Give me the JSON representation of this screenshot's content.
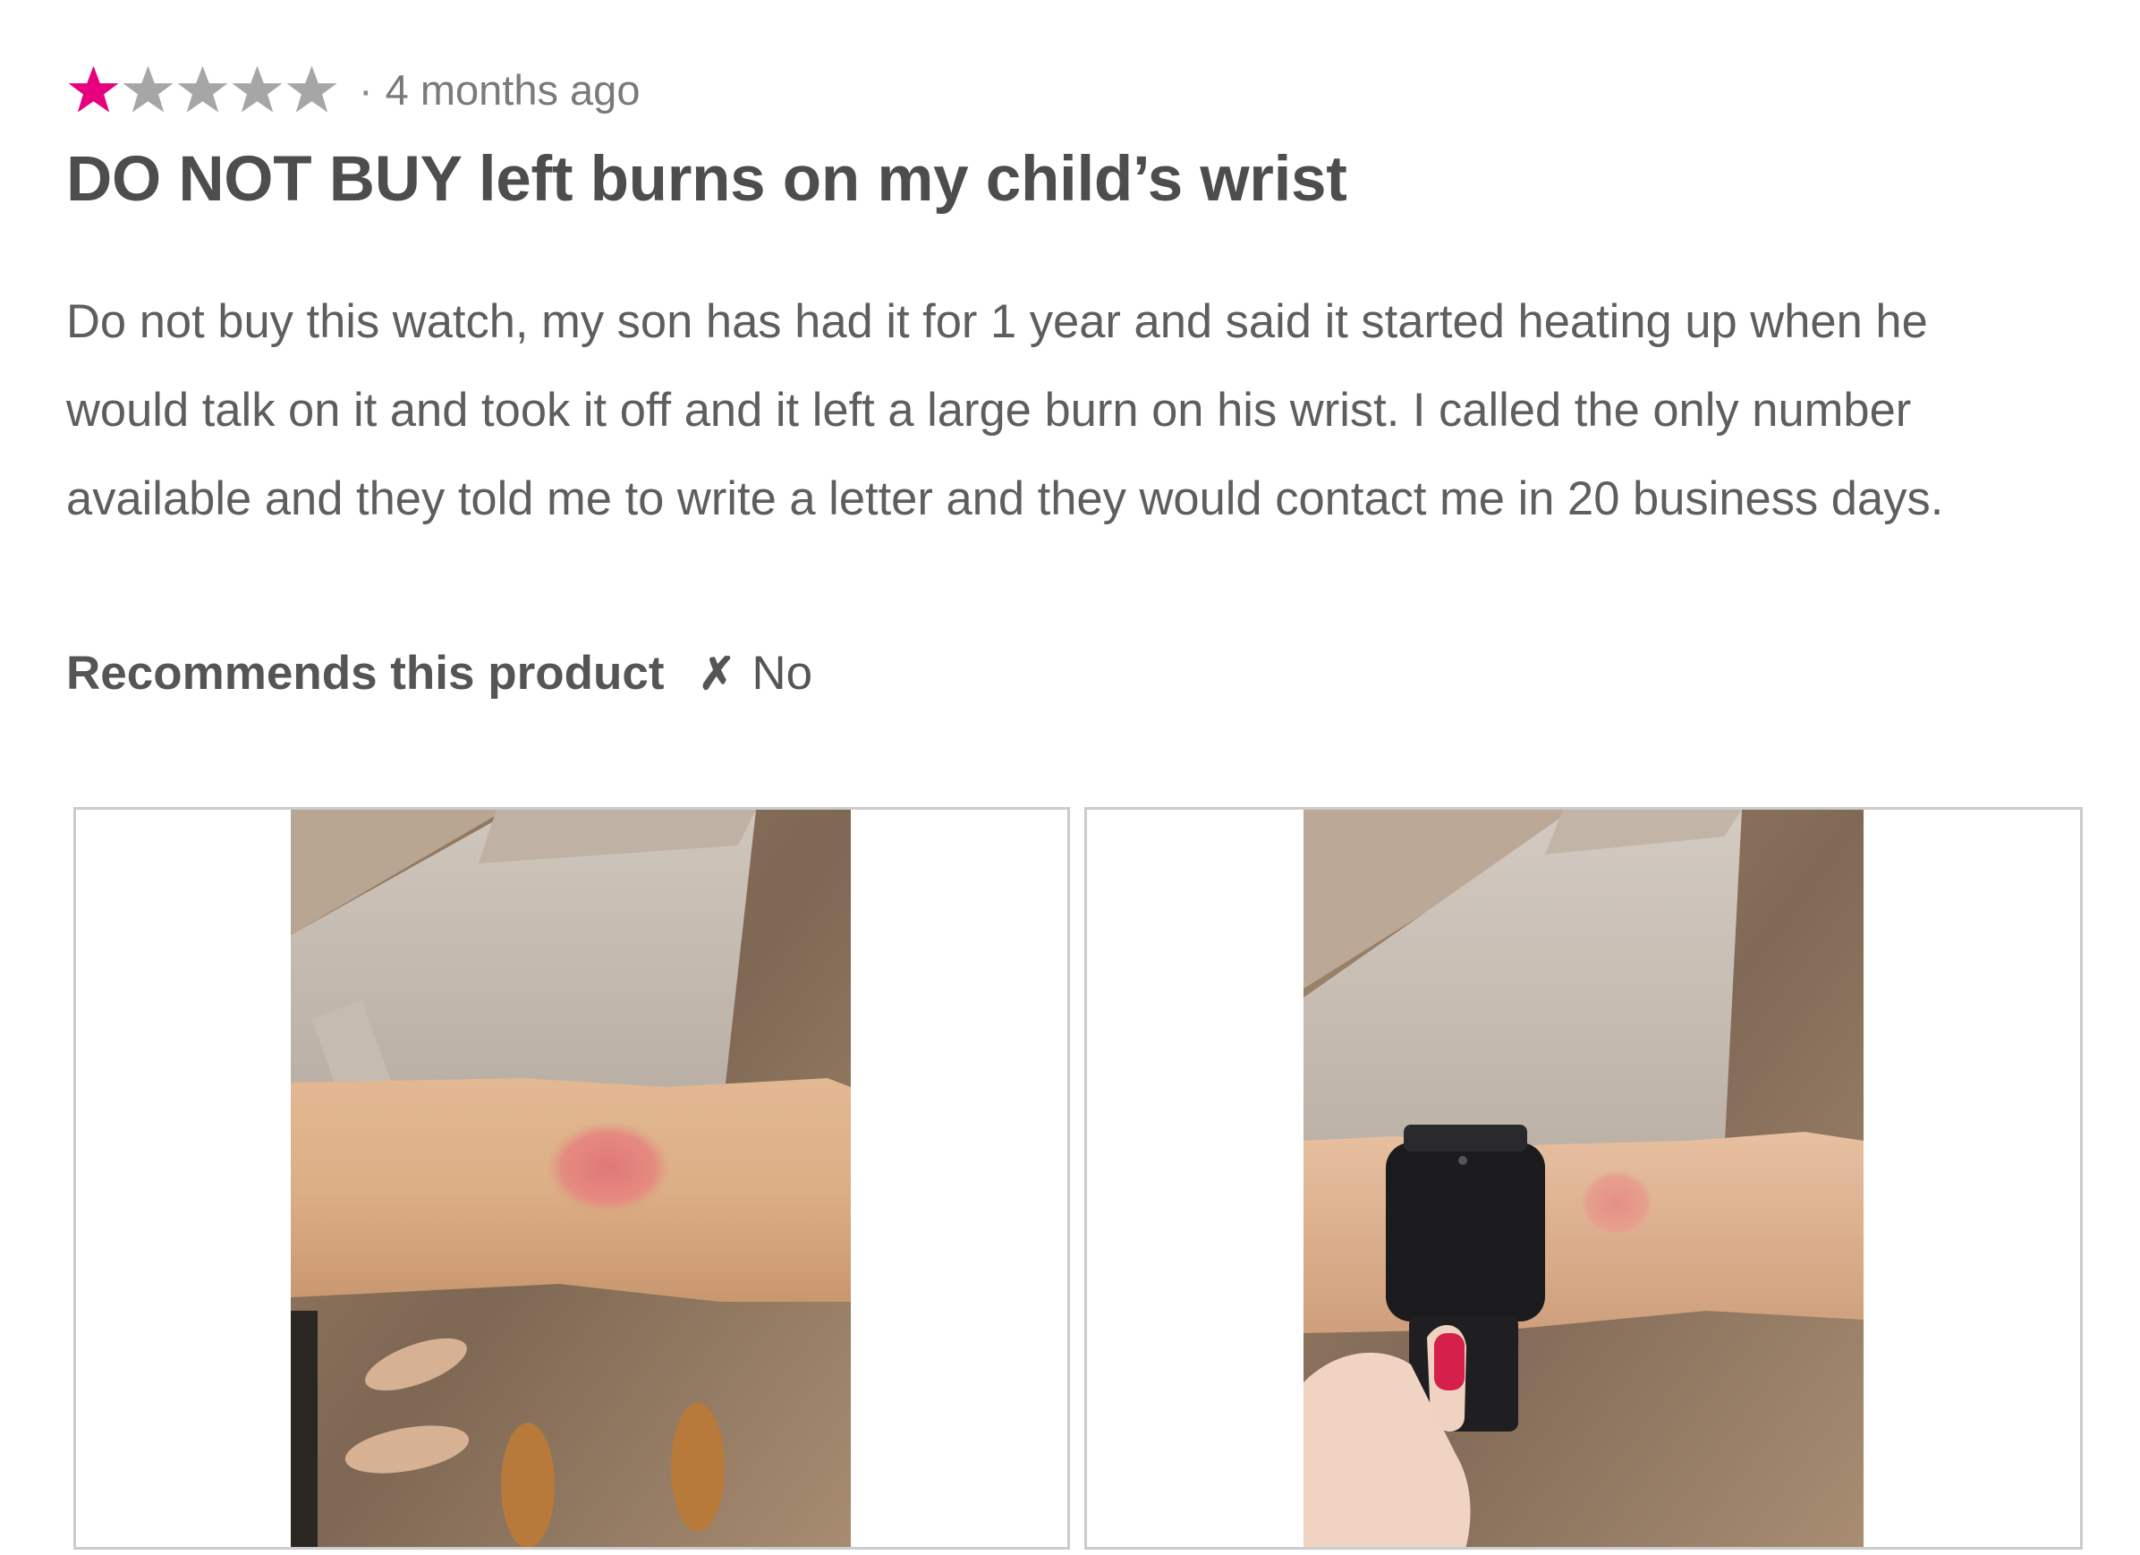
{
  "review": {
    "rating": 1,
    "rating_max": 5,
    "star_color_filled": "#e6007e",
    "star_color_empty": "#a6a6a6",
    "separator": "·",
    "date": "4 months ago",
    "title": "DO NOT BUY left burns on my child’s wrist",
    "body_lines": [
      "Do not buy this watch, my son has had it for 1 year and said it started heating up when he",
      "would talk on it and took it off and it left a large burn on his wrist. I called the only number",
      "available and they told me to write a letter and they would contact me in 20 business days."
    ],
    "recommends": {
      "label": "Recommends this product",
      "icon": "x-mark-icon",
      "icon_glyph": "✗",
      "value": "No"
    },
    "photos": [
      {
        "content": "photo of a child's forearm with a round red burn mark"
      },
      {
        "content": "photo of the same arm with a black smartwatch held next to the burn mark"
      }
    ]
  }
}
